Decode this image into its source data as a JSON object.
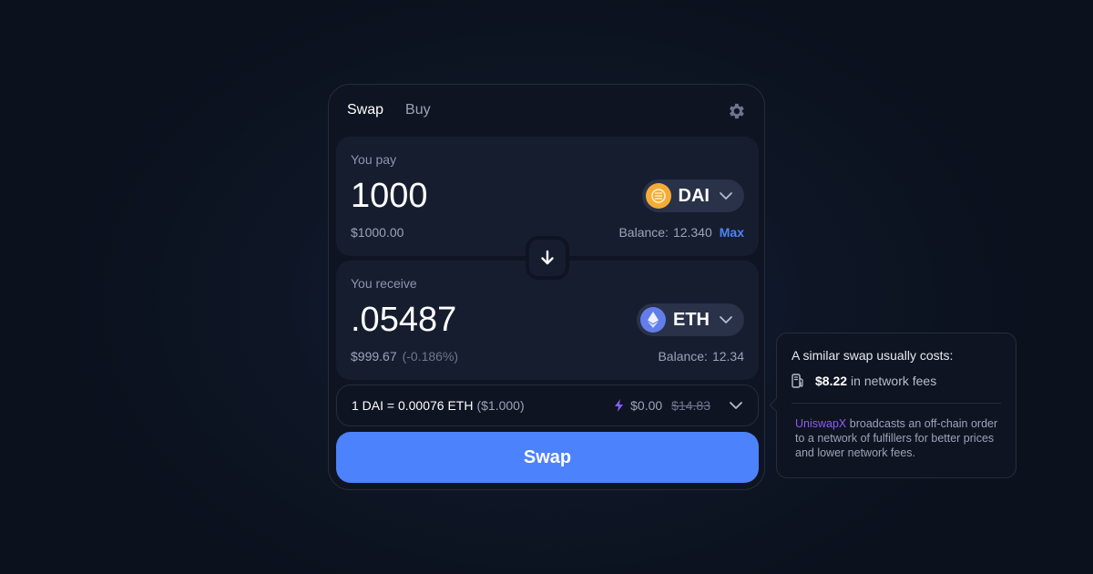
{
  "tabs": [
    {
      "label": "Swap",
      "active": true
    },
    {
      "label": "Buy",
      "active": false
    }
  ],
  "pay": {
    "label": "You pay",
    "amount": "1000",
    "usd": "$1000.00",
    "token": "DAI",
    "token_icon": "dai-icon",
    "balance_label": "Balance:",
    "balance_value": "12.340",
    "max_label": "Max"
  },
  "receive": {
    "label": "You receive",
    "amount": ".05487",
    "usd": "$999.67",
    "usd_change": "(-0.186%)",
    "token": "ETH",
    "token_icon": "eth-icon",
    "balance_label": "Balance:",
    "balance_value": "12.34"
  },
  "rate": {
    "text": "1 DAI = 0.00076 ETH",
    "usd": "($1.000)",
    "fee": "$0.00",
    "fee_strike": "$14.83"
  },
  "swap_button": "Swap",
  "tooltip": {
    "title": "A similar swap usually costs:",
    "fee": "$8.22",
    "fee_suffix": "in network fees",
    "link": "UniswapX",
    "body": "broadcasts an off-chain order to a network of fulfillers for better prices and lower network fees."
  },
  "colors": {
    "accent": "#4c82fb",
    "uniswapx": "#8b5cf6",
    "dai": "#f5ac37",
    "eth": "#627eea"
  }
}
